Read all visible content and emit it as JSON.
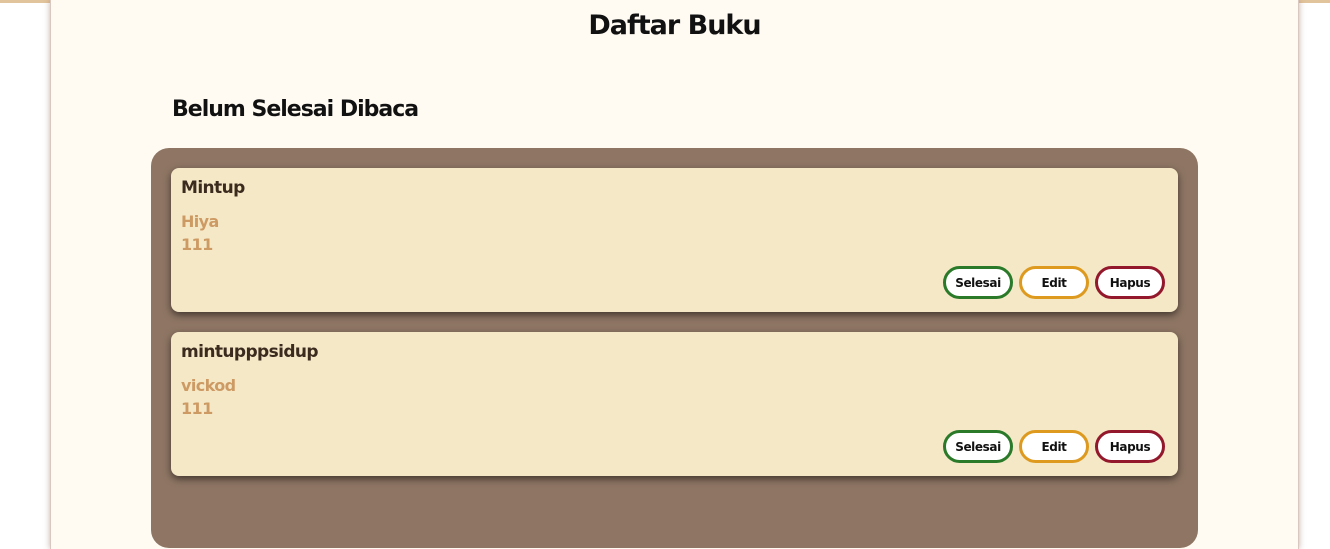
{
  "page": {
    "title": "Daftar Buku"
  },
  "section": {
    "title": "Belum Selesai Dibaca"
  },
  "books": [
    {
      "title": "Mintup",
      "author": "Hiya",
      "year": "111"
    },
    {
      "title": "mintupppsidup",
      "author": "vickod",
      "year": "111"
    }
  ],
  "actions": {
    "done_label": "Selesai",
    "edit_label": "Edit",
    "delete_label": "Hapus"
  },
  "colors": {
    "background": "#fffbf3",
    "shelf": "#8f7664",
    "card": "#f5e8c7",
    "title_text": "#3b2a1e",
    "meta_text": "#cd9a64",
    "done_border": "#2a7a2a",
    "edit_border": "#dd9a1f",
    "delete_border": "#94182c"
  }
}
